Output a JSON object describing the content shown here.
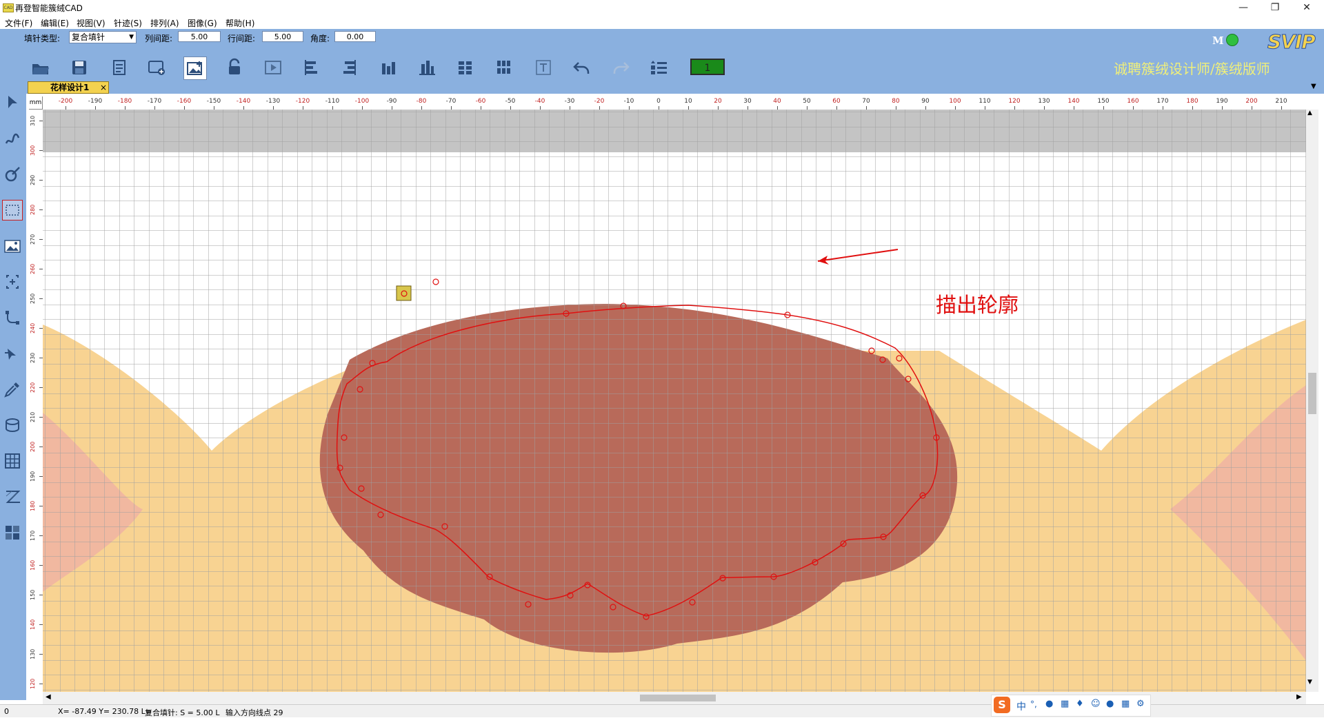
{
  "window": {
    "title": "再登智能簇绒CAD",
    "controls": [
      "minimize-icon",
      "maximize-icon",
      "close-icon"
    ]
  },
  "menu": [
    "文件(F)",
    "编辑(E)",
    "视图(V)",
    "针迹(S)",
    "排列(A)",
    "图像(G)",
    "帮助(H)"
  ],
  "params": {
    "fill_type_label": "填针类型:",
    "fill_type_value": "复合填针",
    "col_spacing_label": "列间距:",
    "col_spacing_value": "5.00",
    "row_spacing_label": "行间距:",
    "row_spacing_value": "5.00",
    "angle_label": "角度:",
    "angle_value": "0.00"
  },
  "status_light": {
    "letter": "M",
    "color": "#2fbf3f"
  },
  "brand": {
    "logo_text": "SVIP",
    "recruit_text": "诚聘簇绒设计师/簇绒版师"
  },
  "toolbar_icons": [
    "open-folder-icon",
    "save-icon",
    "document-icon",
    "add-window-icon",
    "insert-image-icon",
    "lock-icon",
    "play-icon",
    "align-left-icon",
    "align-right-icon",
    "align-bottom-icon",
    "align-bottom-alt-icon",
    "distribute-horizontal-icon",
    "distribute-vertical-icon",
    "text-icon",
    "undo-icon",
    "redo-icon",
    "list-settings-icon"
  ],
  "counter_value": "1",
  "tab": {
    "label": "花样设计1",
    "close": "×"
  },
  "left_tools": [
    "select-arrow-icon",
    "freehand-curve-icon",
    "node-edit-icon",
    "rectangle-select-icon",
    "image-icon",
    "fit-contour-icon",
    "bezier-icon",
    "arrow-edit-icon",
    "eyedropper-icon",
    "stack-layers-icon",
    "grid-fill-icon",
    "zigzag-stitch-icon",
    "blocks-icon"
  ],
  "ruler": {
    "unit": "mm",
    "top_ticks": [
      "-200",
      "-190",
      "-180",
      "-170",
      "-160",
      "-150",
      "-140",
      "-130",
      "-120",
      "-110",
      "-100",
      "-90",
      "-80",
      "-70",
      "-60",
      "-50",
      "-40",
      "-30",
      "-20",
      "-10",
      "0",
      "10",
      "20",
      "30",
      "40",
      "50",
      "60",
      "70",
      "80",
      "90",
      "100",
      "110",
      "120",
      "130",
      "140",
      "150",
      "160",
      "170",
      "180",
      "190",
      "200",
      "210"
    ],
    "left_ticks": [
      "310",
      "300",
      "290",
      "280",
      "270",
      "260",
      "250",
      "240",
      "230",
      "220",
      "210",
      "200",
      "190",
      "180",
      "170",
      "160",
      "150",
      "140",
      "130",
      "120"
    ]
  },
  "annotation": {
    "text": "描出轮廓",
    "color": "#e01010"
  },
  "status": {
    "coord_zero": "0",
    "coords": "X= -87.49 Y= 230.78 L=",
    "fill_info": "复合填针: S = 5.00 L",
    "prompt": "输入方向线点 29"
  },
  "ime": {
    "label": "中"
  },
  "colors": {
    "chrome": "#8ab0df",
    "fill_orange": "#f8d392",
    "fill_pink": "#f0b3a2",
    "fill_brown": "#b86a5a",
    "contour": "#e01010",
    "grid": "#a0a0a0",
    "gray_band": "#c4c4c4"
  }
}
